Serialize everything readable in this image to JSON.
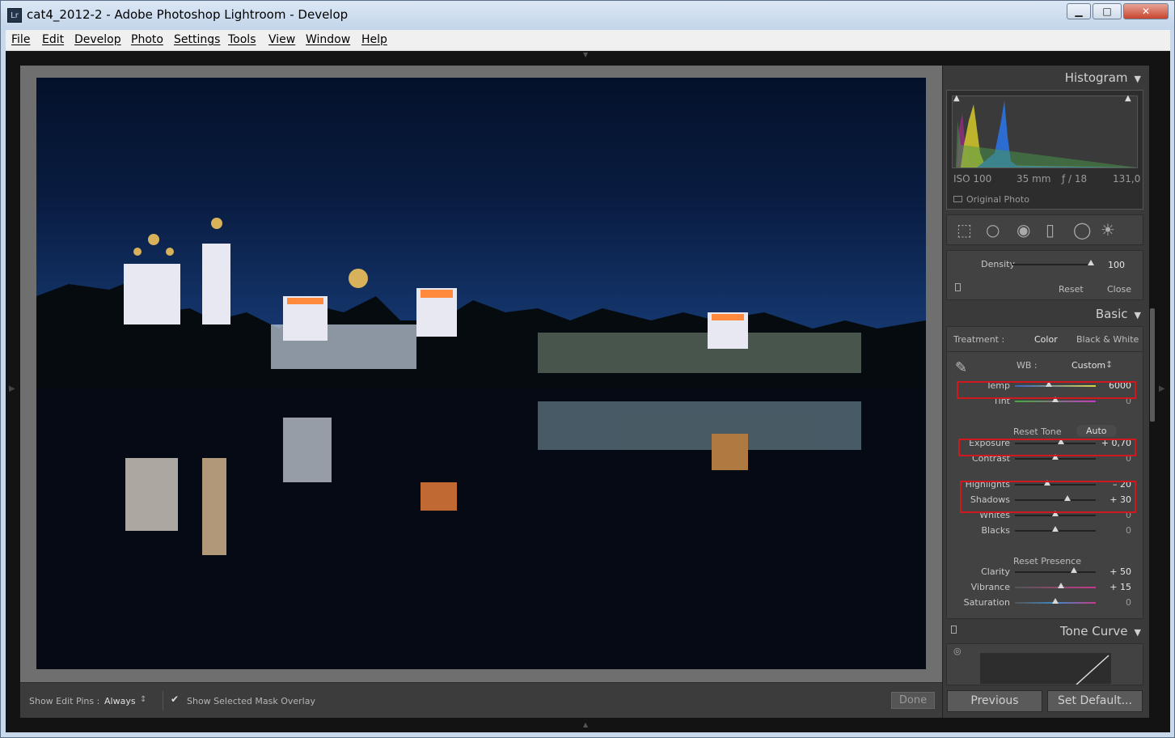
{
  "window": {
    "title": "cat4_2012-2 - Adobe Photoshop Lightroom - Develop",
    "icon": "Lr"
  },
  "menu": [
    "File",
    "Edit",
    "Develop",
    "Photo",
    "Settings",
    "Tools",
    "View",
    "Window",
    "Help"
  ],
  "toolbar": {
    "pins_label": "Show Edit Pins :",
    "pins_value": "Always",
    "mask_label": "Show Selected Mask Overlay",
    "mask_checked": true,
    "done_label": "Done"
  },
  "histogram": {
    "title": "Histogram",
    "iso": "ISO 100",
    "focal": "35 mm",
    "aperture": "ƒ / 18",
    "shutter": "131,0",
    "original_photo": "Original Photo"
  },
  "mask": {
    "density_label": "Density",
    "density_value": "100",
    "density_fraction": 1.0,
    "reset": "Reset",
    "close": "Close"
  },
  "basic": {
    "title": "Basic",
    "treatment_label": "Treatment :",
    "color": "Color",
    "bw": "Black & White",
    "wb_label": "WB :",
    "wb_value": "Custom",
    "reset_tone": "Reset Tone",
    "auto": "Auto",
    "reset_presence": "Reset Presence",
    "sliders": [
      {
        "label": "Temp",
        "value": "6000",
        "fraction": 0.42,
        "group": "wb",
        "highlight": true
      },
      {
        "label": "Tint",
        "value": "0",
        "fraction": 0.5,
        "group": "wb",
        "highlight": false
      },
      {
        "label": "Exposure",
        "value": "+ 0,70",
        "fraction": 0.57,
        "group": "tone",
        "highlight": true
      },
      {
        "label": "Contrast",
        "value": "0",
        "fraction": 0.5,
        "group": "tone",
        "highlight": false
      },
      {
        "label": "Highlights",
        "value": "– 20",
        "fraction": 0.4,
        "group": "tone",
        "highlight": true
      },
      {
        "label": "Shadows",
        "value": "+ 30",
        "fraction": 0.65,
        "group": "tone",
        "highlight": true
      },
      {
        "label": "Whites",
        "value": "0",
        "fraction": 0.5,
        "group": "tone",
        "highlight": false
      },
      {
        "label": "Blacks",
        "value": "0",
        "fraction": 0.5,
        "group": "tone",
        "highlight": false
      },
      {
        "label": "Clarity",
        "value": "+ 50",
        "fraction": 0.73,
        "group": "presence",
        "highlight": false
      },
      {
        "label": "Vibrance",
        "value": "+ 15",
        "fraction": 0.57,
        "group": "presence",
        "highlight": false
      },
      {
        "label": "Saturation",
        "value": "0",
        "fraction": 0.5,
        "group": "presence",
        "highlight": false
      }
    ]
  },
  "tone_curve": {
    "title": "Tone Curve"
  },
  "buttons": {
    "previous": "Previous",
    "set_default": "Set Default..."
  }
}
